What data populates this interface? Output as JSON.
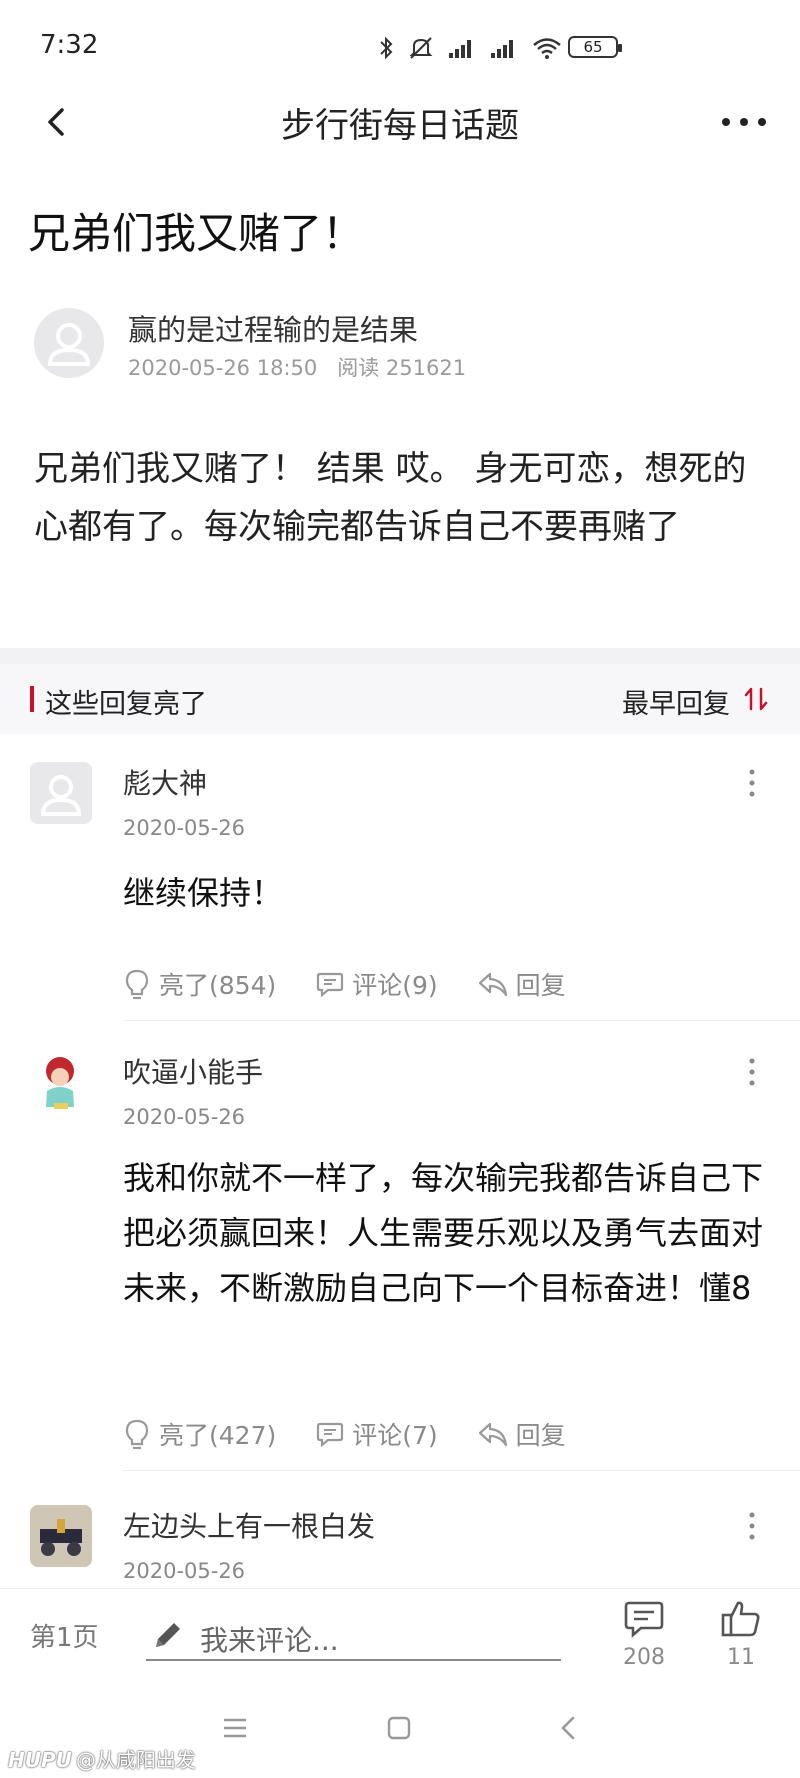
{
  "status_bar": {
    "time": "7:32",
    "battery": "65"
  },
  "nav": {
    "title": "步行街每日话题"
  },
  "post": {
    "title": "兄弟们我又赌了！",
    "author": "赢的是过程输的是结果",
    "date": "2020-05-26 18:50",
    "views": "阅读 251621",
    "body": "兄弟们我又赌了！ 结果 哎。 身无可恋，想死的心都有了。每次输完都告诉自己不要再赌了"
  },
  "replies_header": {
    "title": "这些回复亮了",
    "sort_label": "最早回复"
  },
  "comments": [
    {
      "name": "彪大神",
      "date": "2020-05-26",
      "body": "继续保持！",
      "like_label": "亮了(854)",
      "comment_label": "评论(9)",
      "reply_label": "回复"
    },
    {
      "name": "吹逼小能手",
      "date": "2020-05-26",
      "body": "我和你就不一样了，每次输完我都告诉自己下把必须赢回来！人生需要乐观以及勇气去面对未来，不断激励自己向下一个目标奋进！懂8",
      "like_label": "亮了(427)",
      "comment_label": "评论(7)",
      "reply_label": "回复"
    },
    {
      "name": "左边头上有一根白发",
      "date": "2020-05-26"
    }
  ],
  "bottom_bar": {
    "page_label": "第1页",
    "input_placeholder": "我来评论...",
    "comment_count": "208",
    "like_count": "11"
  },
  "watermark": {
    "brand": "HUPU",
    "text": "@从咸阳出发"
  },
  "colors": {
    "accent": "#c8102e",
    "muted": "#8a8a8a"
  },
  "icons": [
    "back-icon",
    "more-icon",
    "sort-icon",
    "lightbulb-icon",
    "comment-icon",
    "reply-icon",
    "pencil-icon",
    "thumbs-up-icon"
  ]
}
